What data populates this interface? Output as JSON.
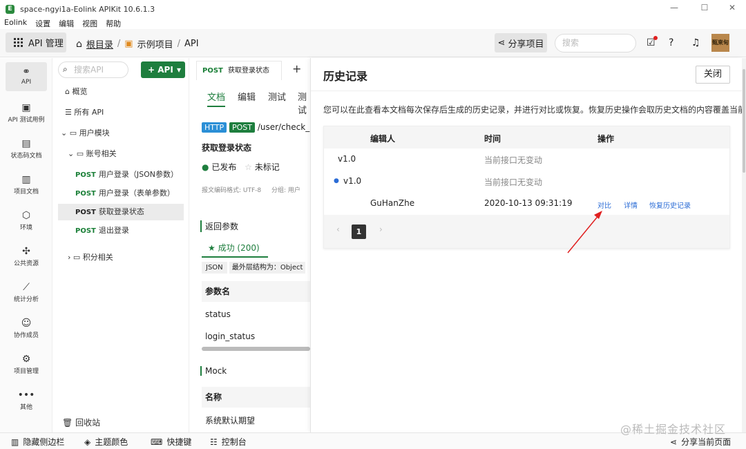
{
  "window": {
    "title": "space-ngyi1a-Eolink APIKit 10.6.1.3",
    "logo_letter": "E",
    "minimize": "—",
    "maximize": "☐",
    "close": "✕"
  },
  "menu": [
    "Eolink",
    "设置",
    "编辑",
    "视图",
    "帮助"
  ],
  "toolbar": {
    "api_mgmt": "API 管理",
    "breadcrumb": {
      "root": "根目录",
      "sep1": "/",
      "project": "示例项目",
      "sep2": "/",
      "current": "API"
    },
    "share_project": "分享项目",
    "search_placeholder": "搜索",
    "avatar_text": "甄柬甸"
  },
  "rail": [
    {
      "label": "API",
      "icon": "⚭"
    },
    {
      "label": "API 测试用例",
      "icon": "▣"
    },
    {
      "label": "状态码文档",
      "icon": "▤"
    },
    {
      "label": "项目文档",
      "icon": "▥"
    },
    {
      "label": "环境",
      "icon": "⬡"
    },
    {
      "label": "公共资源",
      "icon": "✣"
    },
    {
      "label": "统计分析",
      "icon": "⟋"
    },
    {
      "label": "协作成员",
      "icon": "☺"
    },
    {
      "label": "项目管理",
      "icon": "⚙"
    },
    {
      "label": "其他",
      "icon": "•••"
    }
  ],
  "tree": {
    "search_placeholder": "搜索API",
    "add_api": "+ API",
    "add_caret": "▾",
    "items": {
      "overview": "概览",
      "all_api": "所有 API",
      "user_module": "用户模块",
      "account": "账号相关",
      "api1_method": "POST",
      "api1": "用户登录（JSON参数）",
      "api2_method": "POST",
      "api2": "用户登录（表单参数）",
      "api3_method": "POST",
      "api3": "获取登录状态",
      "api4_method": "POST",
      "api4": "退出登录",
      "points": "积分相关",
      "recycle": "回收站"
    }
  },
  "doc": {
    "tab_method": "POST",
    "tab_title": "获取登录状态",
    "tab_close": "✕",
    "add_tab": "+",
    "subtabs": [
      "文档",
      "编辑",
      "测试",
      "测试"
    ],
    "http_badge": "HTTP",
    "post_badge": "POST",
    "url": "/user/check_lo",
    "api_name": "获取登录状态",
    "status_published": "已发布",
    "status_unmarked": "未标记",
    "encoding": "报文编码格式: UTF-8",
    "group": "分组: 用户",
    "return_params": "返回参数",
    "success_tab": "★ 成功 (200)",
    "json_label": "JSON",
    "outer_structure": "最外层结构为：Object",
    "param_name_header": "参数名",
    "params": [
      "status",
      "login_status"
    ],
    "mock": "Mock",
    "name_header": "名称",
    "mock_row": "系统默认期望"
  },
  "history": {
    "title": "历史记录",
    "close": "关闭",
    "description": "您可以在此查看本文档每次保存后生成的历史记录，并进行对比或恢复。恢复历史操作会取历史文档的内容覆盖当前文",
    "headers": {
      "editor": "编辑人",
      "time": "时间",
      "actions": "操作"
    },
    "rows": [
      {
        "version": "v1.0",
        "editor": "",
        "time": "当前接口无变动"
      },
      {
        "version": "v1.0",
        "editor": "",
        "time": "当前接口无变动"
      },
      {
        "version": "",
        "editor": "GuHanZhe",
        "time": "2020-10-13 09:31:19",
        "compare": "对比",
        "detail": "详情",
        "restore": "恢复历史记录"
      }
    ],
    "pager": {
      "prev": "‹",
      "page": "1",
      "next": "›"
    }
  },
  "bottom": {
    "hide_sidebar": "隐藏侧边栏",
    "theme": "主题颜色",
    "shortcuts": "快捷键",
    "console": "控制台",
    "share_page": "分享当前页面"
  },
  "watermark": "@稀土掘金技术社区",
  "colors": {
    "accent_green": "#1e7e3e",
    "link_blue": "#2b6cd6",
    "annotation_red": "#e02020",
    "badge_blue": "#2b8fd6"
  }
}
